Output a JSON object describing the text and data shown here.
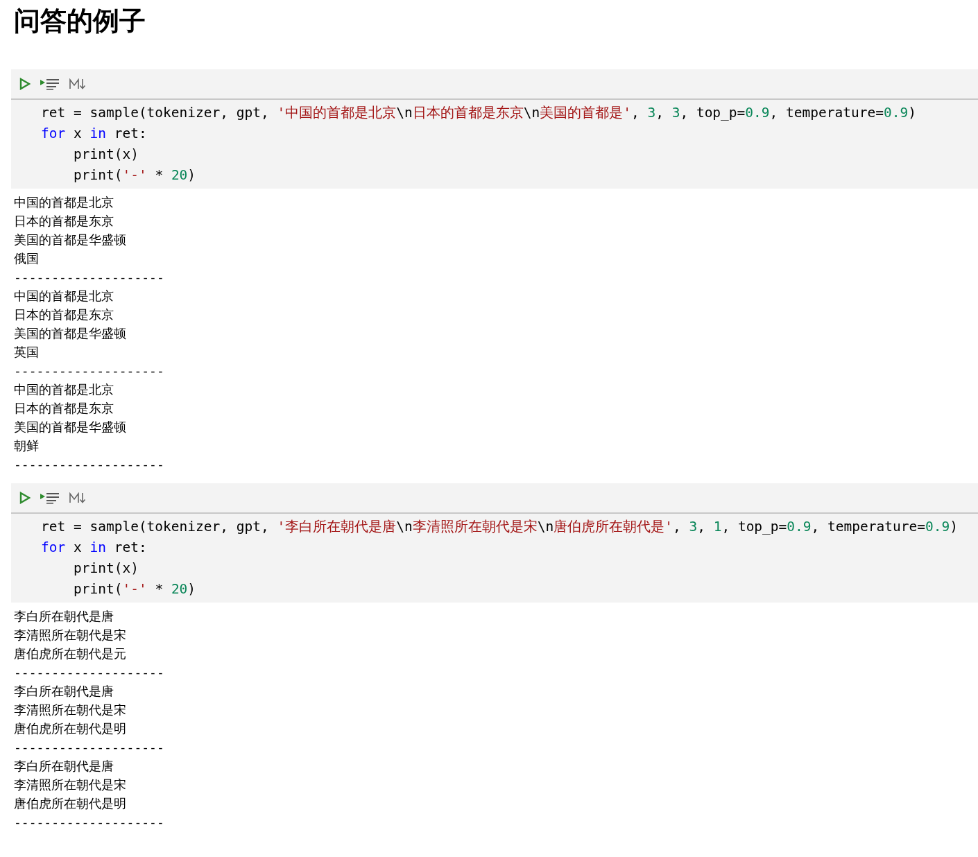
{
  "title": "问答的例子",
  "cells": [
    {
      "code_lines": [
        [
          {
            "kind": "plain",
            "text": "ret = sample(tokenizer, gpt, "
          },
          {
            "kind": "string",
            "text": "'中国的首都是北京"
          },
          {
            "kind": "plain",
            "text": "\\n"
          },
          {
            "kind": "string",
            "text": "日本的首都是东京"
          },
          {
            "kind": "plain",
            "text": "\\n"
          },
          {
            "kind": "string",
            "text": "美国的首都是'"
          },
          {
            "kind": "plain",
            "text": ", "
          },
          {
            "kind": "number",
            "text": "3"
          },
          {
            "kind": "plain",
            "text": ", "
          },
          {
            "kind": "number",
            "text": "3"
          },
          {
            "kind": "plain",
            "text": ", top_p="
          },
          {
            "kind": "number",
            "text": "0.9"
          },
          {
            "kind": "plain",
            "text": ", temperature="
          },
          {
            "kind": "number",
            "text": "0.9"
          },
          {
            "kind": "plain",
            "text": ")"
          }
        ],
        [
          {
            "kind": "keyword",
            "text": "for"
          },
          {
            "kind": "plain",
            "text": " x "
          },
          {
            "kind": "keyword",
            "text": "in"
          },
          {
            "kind": "plain",
            "text": " ret:"
          }
        ],
        [
          {
            "kind": "plain",
            "text": "    print(x)"
          }
        ],
        [
          {
            "kind": "plain",
            "text": "    print("
          },
          {
            "kind": "string",
            "text": "'-'"
          },
          {
            "kind": "plain",
            "text": " * "
          },
          {
            "kind": "number",
            "text": "20"
          },
          {
            "kind": "plain",
            "text": ")"
          }
        ]
      ],
      "output_lines": [
        "中国的首都是北京",
        "日本的首都是东京",
        "美国的首都是华盛顿",
        "俄国",
        "--------------------",
        "中国的首都是北京",
        "日本的首都是东京",
        "美国的首都是华盛顿",
        "英国",
        "--------------------",
        "中国的首都是北京",
        "日本的首都是东京",
        "美国的首都是华盛顿",
        "朝鲜",
        "--------------------"
      ]
    },
    {
      "code_lines": [
        [
          {
            "kind": "plain",
            "text": "ret = sample(tokenizer, gpt, "
          },
          {
            "kind": "string",
            "text": "'李白所在朝代是唐"
          },
          {
            "kind": "plain",
            "text": "\\n"
          },
          {
            "kind": "string",
            "text": "李清照所在朝代是宋"
          },
          {
            "kind": "plain",
            "text": "\\n"
          },
          {
            "kind": "string",
            "text": "唐伯虎所在朝代是'"
          },
          {
            "kind": "plain",
            "text": ", "
          },
          {
            "kind": "number",
            "text": "3"
          },
          {
            "kind": "plain",
            "text": ", "
          },
          {
            "kind": "number",
            "text": "1"
          },
          {
            "kind": "plain",
            "text": ", top_p="
          },
          {
            "kind": "number",
            "text": "0.9"
          },
          {
            "kind": "plain",
            "text": ", temperature="
          },
          {
            "kind": "number",
            "text": "0.9"
          },
          {
            "kind": "plain",
            "text": ")"
          }
        ],
        [
          {
            "kind": "keyword",
            "text": "for"
          },
          {
            "kind": "plain",
            "text": " x "
          },
          {
            "kind": "keyword",
            "text": "in"
          },
          {
            "kind": "plain",
            "text": " ret:"
          }
        ],
        [
          {
            "kind": "plain",
            "text": "    print(x)"
          }
        ],
        [
          {
            "kind": "plain",
            "text": "    print("
          },
          {
            "kind": "string",
            "text": "'-'"
          },
          {
            "kind": "plain",
            "text": " * "
          },
          {
            "kind": "number",
            "text": "20"
          },
          {
            "kind": "plain",
            "text": ")"
          }
        ]
      ],
      "output_lines": [
        "李白所在朝代是唐",
        "李清照所在朝代是宋",
        "唐伯虎所在朝代是元",
        "--------------------",
        "李白所在朝代是唐",
        "李清照所在朝代是宋",
        "唐伯虎所在朝代是明",
        "--------------------",
        "李白所在朝代是唐",
        "李清照所在朝代是宋",
        "唐伯虎所在朝代是明",
        "--------------------"
      ]
    }
  ]
}
